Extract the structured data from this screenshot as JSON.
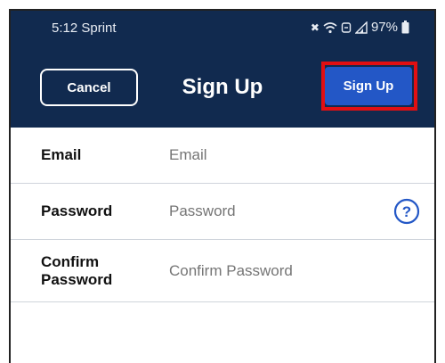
{
  "status_bar": {
    "carrier": "5:12 Sprint",
    "battery": "97%"
  },
  "navbar": {
    "cancel_label": "Cancel",
    "title": "Sign Up",
    "signup_label": "Sign Up"
  },
  "form": {
    "email": {
      "label": "Email",
      "placeholder": "Email"
    },
    "password": {
      "label": "Password",
      "placeholder": "Password"
    },
    "confirm": {
      "label_line1": "Confirm",
      "label_line2": "Password",
      "placeholder": "Confirm Password"
    }
  },
  "colors": {
    "nav_background": "#112a4f",
    "primary_button": "#2357c6",
    "highlight": "#e10f12"
  },
  "icons": [
    "mute-icon",
    "wifi-icon",
    "data-icon",
    "signal-icon",
    "battery-icon",
    "help-icon"
  ]
}
